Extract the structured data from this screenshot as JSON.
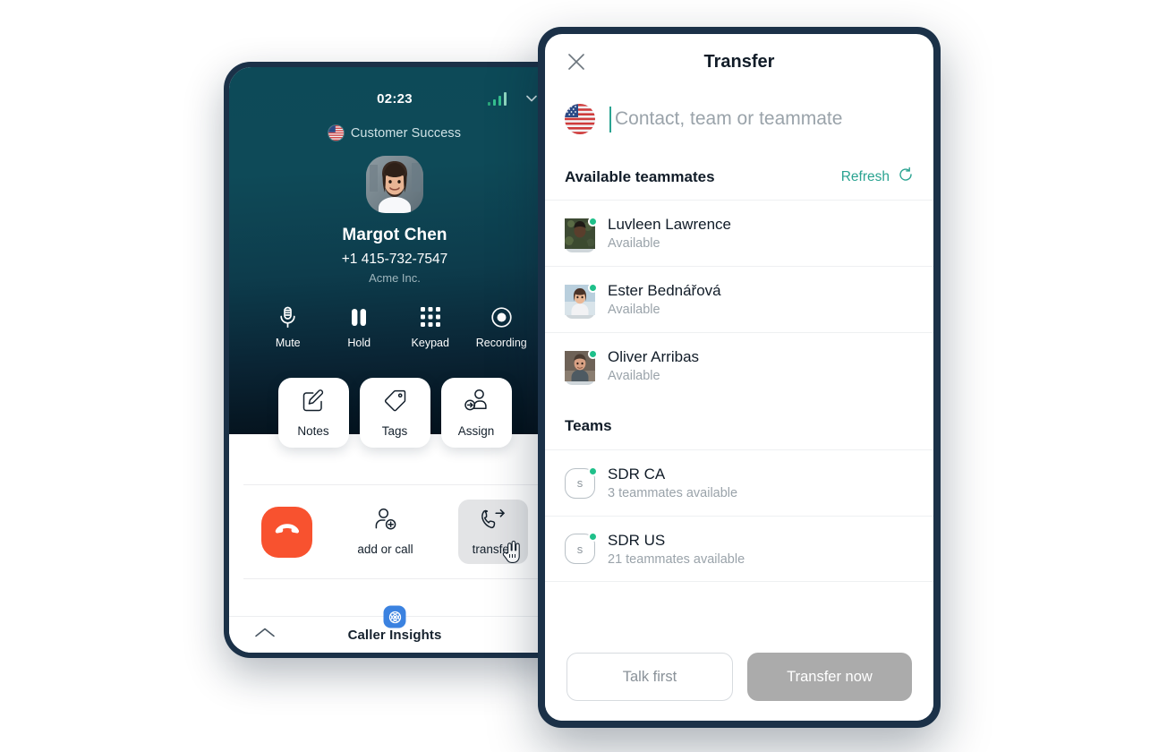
{
  "call_panel": {
    "timer": "02:23",
    "signal_icon": "signal-bars-icon",
    "collapse_icon": "chevron-down-icon",
    "queue_flag": "us-flag-icon",
    "queue_label": "Customer Success",
    "caller_avatar": "caller-avatar-photo",
    "caller_name": "Margot Chen",
    "caller_phone": "+1 415-732-7547",
    "caller_company": "Acme Inc.",
    "controls": [
      {
        "label": "Mute",
        "icon": "microphone-icon"
      },
      {
        "label": "Hold",
        "icon": "pause-icon"
      },
      {
        "label": "Keypad",
        "icon": "keypad-grid-icon"
      },
      {
        "label": "Recording",
        "icon": "record-circle-icon"
      }
    ],
    "action_cards": [
      {
        "label": "Notes",
        "icon": "note-pencil-icon"
      },
      {
        "label": "Tags",
        "icon": "tag-icon"
      },
      {
        "label": "Assign",
        "icon": "assign-user-icon"
      }
    ],
    "bottom_actions": {
      "hangup_icon": "hangup-phone-icon",
      "add_call_label": "add or call",
      "add_call_icon": "add-person-icon",
      "transfer_label": "transfer",
      "transfer_icon": "transfer-call-icon",
      "cursor_icon": "hand-cursor-icon"
    },
    "insights": {
      "label": "Caller Insights",
      "badge_icon": "caller-insights-icon",
      "expand_icon": "chevron-up-icon"
    }
  },
  "transfer_panel": {
    "title": "Transfer",
    "close_icon": "close-icon",
    "search": {
      "flag_icon": "us-flag-icon",
      "value": "",
      "placeholder": "Contact, team or teammate"
    },
    "teammates_section": {
      "title": "Available teammates",
      "refresh_label": "Refresh",
      "refresh_icon": "refresh-icon",
      "items": [
        {
          "name": "Luvleen Lawrence",
          "status": "Available",
          "avatar": "avatar-photo",
          "presence": "online"
        },
        {
          "name": "Ester Bednářová",
          "status": "Available",
          "avatar": "avatar-photo",
          "presence": "online"
        },
        {
          "name": "Oliver Arribas",
          "status": "Available",
          "avatar": "avatar-photo",
          "presence": "online"
        }
      ]
    },
    "teams_section": {
      "title": "Teams",
      "items": [
        {
          "name": "SDR CA",
          "status": "3 teammates available",
          "initial": "s",
          "presence": "online"
        },
        {
          "name": "SDR US",
          "status": "21 teammates available",
          "initial": "s",
          "presence": "online"
        }
      ]
    },
    "footer": {
      "secondary_label": "Talk first",
      "primary_label": "Transfer now"
    }
  },
  "colors": {
    "accent_teal": "#2aa391",
    "presence_green": "#1fc08a",
    "hangup_orange": "#f8522f",
    "panel_border_navy": "#1b3148",
    "insights_blue": "#3b82e0",
    "primary_button_gray": "#ababab"
  }
}
